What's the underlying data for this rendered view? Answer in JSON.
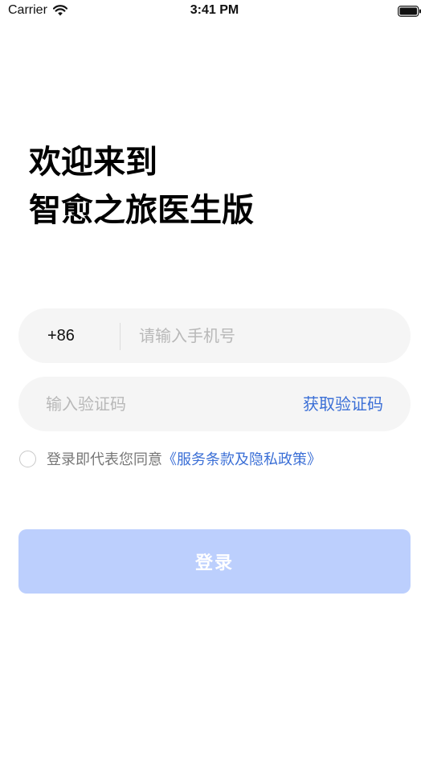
{
  "status_bar": {
    "carrier": "Carrier",
    "time": "3:41 PM"
  },
  "welcome": {
    "line1": "欢迎来到",
    "line2": "智愈之旅医生版"
  },
  "phone": {
    "prefix": "+86",
    "placeholder": "请输入手机号",
    "value": ""
  },
  "code": {
    "placeholder": "输入验证码",
    "value": "",
    "get_code_label": "获取验证码"
  },
  "agreement": {
    "checked": false,
    "text": "登录即代表您同意",
    "link": "《服务条款及隐私政策》"
  },
  "login": {
    "label": "登录"
  },
  "colors": {
    "accent": "#3b6fd6",
    "button_disabled": "#bccffd",
    "field_bg": "#f5f5f5"
  }
}
